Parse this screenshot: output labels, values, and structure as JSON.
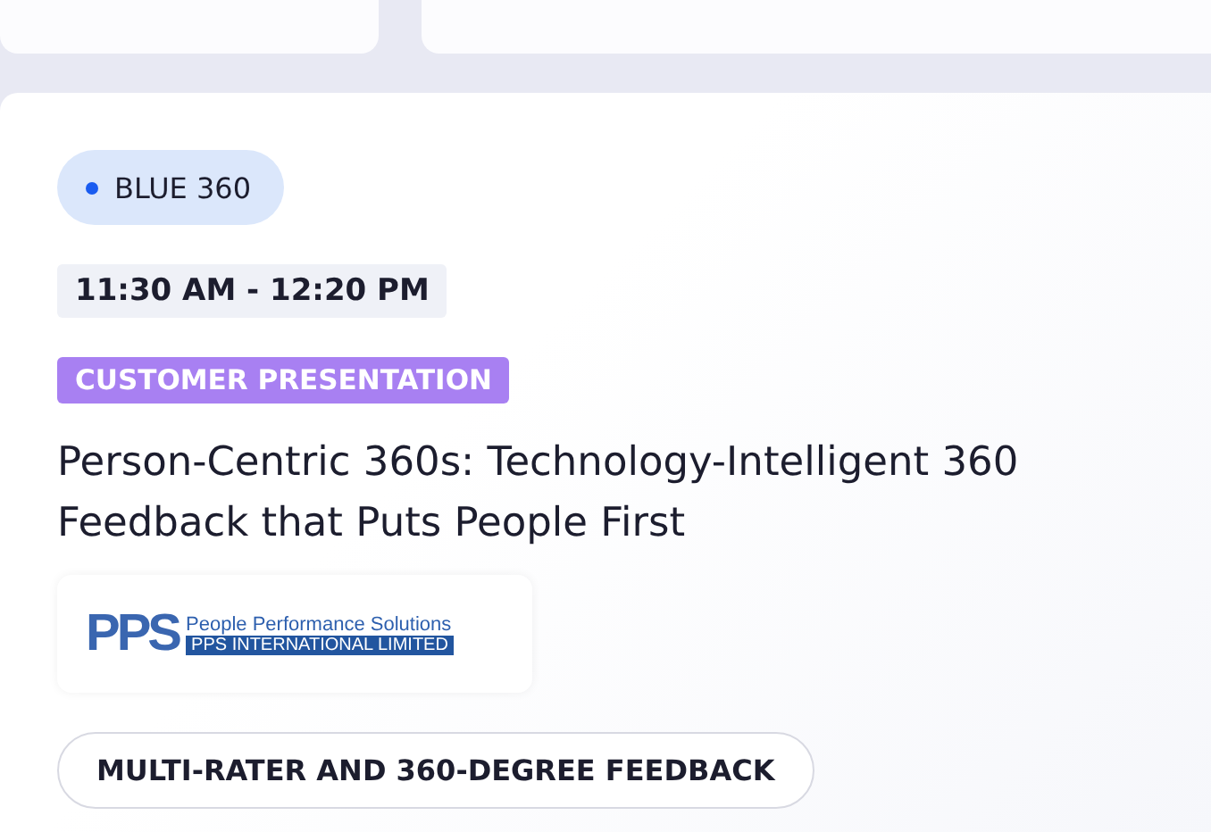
{
  "track": {
    "label": "BLUE 360",
    "color": "#1a5cf0"
  },
  "time": "11:30 AM - 12:20 PM",
  "session_type": "CUSTOMER PRESENTATION",
  "title": "Person-Centric 360s: Technology-Intelligent 360 Feedback that Puts People First",
  "sponsor": {
    "mark": "PPS",
    "name": "People Performance Solutions",
    "company": "PPS INTERNATIONAL LIMITED"
  },
  "topics": [
    "MULTI-RATER AND 360-DEGREE FEEDBACK"
  ]
}
